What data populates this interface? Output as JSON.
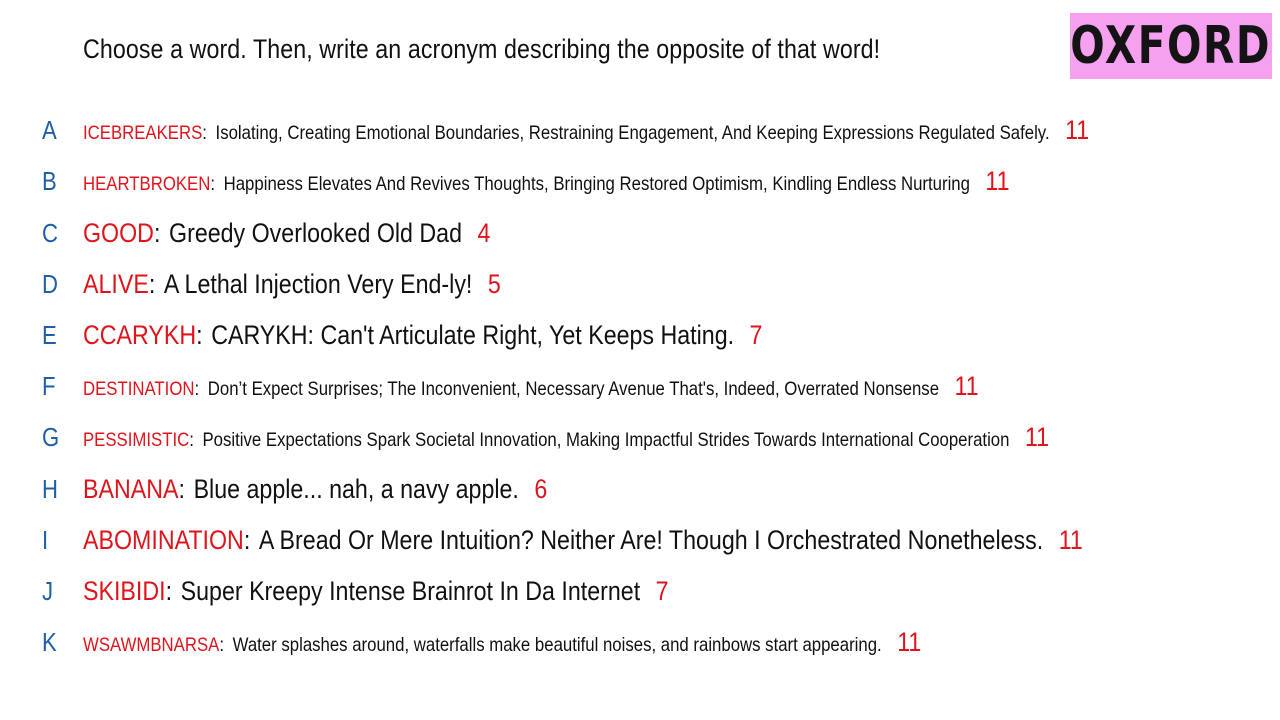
{
  "prompt": "Choose a word. Then, write an acronym describing the opposite of that word!",
  "brand": "OXFORD",
  "rows": [
    {
      "letter": "A",
      "word": "ICEBREAKERS",
      "definition": "Isolating, Creating Emotional Boundaries, Restraining Engagement, And Keeping Expressions Regulated Safely.",
      "count": "11",
      "size": "small"
    },
    {
      "letter": "B",
      "word": "HEARTBROKEN",
      "definition": "Happiness Elevates And Revives Thoughts, Bringing Restored Optimism, Kindling Endless Nurturing",
      "count": "11",
      "size": "small"
    },
    {
      "letter": "C",
      "word": "GOOD",
      "definition": "Greedy Overlooked Old Dad",
      "count": "4",
      "size": "big"
    },
    {
      "letter": "D",
      "word": "ALIVE",
      "definition": "A Lethal Injection Very End-ly!",
      "count": "5",
      "size": "big"
    },
    {
      "letter": "E",
      "word": "CCARYKH",
      "definition": "CARYKH: Can't Articulate Right, Yet Keeps Hating.",
      "count": "7",
      "size": "big"
    },
    {
      "letter": "F",
      "word": "DESTINATION",
      "definition": "Don’t Expect Surprises; The Inconvenient, Necessary Avenue That's, Indeed, Overrated Nonsense",
      "count": "11",
      "size": "small"
    },
    {
      "letter": "G",
      "word": "PESSIMISTIC",
      "definition": "Positive Expectations Spark Societal Innovation, Making Impactful Strides Towards International Cooperation",
      "count": "11",
      "size": "small"
    },
    {
      "letter": "H",
      "word": "BANANA",
      "definition": "Blue apple... nah, a navy apple.",
      "count": "6",
      "size": "big"
    },
    {
      "letter": "I",
      "word": "ABOMINATION",
      "definition": "A Bread Or Mere Intuition? Neither Are! Though I Orchestrated Nonetheless.",
      "count": "11",
      "size": "big"
    },
    {
      "letter": "J",
      "word": "SKIBIDI",
      "definition": "Super Kreepy Intense Brainrot In Da Internet",
      "count": "7",
      "size": "big"
    },
    {
      "letter": "K",
      "word": "WSAWMBNARSA",
      "definition": "Water splashes around, waterfalls make beautiful noises, and rainbows start appearing.",
      "count": "11",
      "size": "small"
    }
  ]
}
